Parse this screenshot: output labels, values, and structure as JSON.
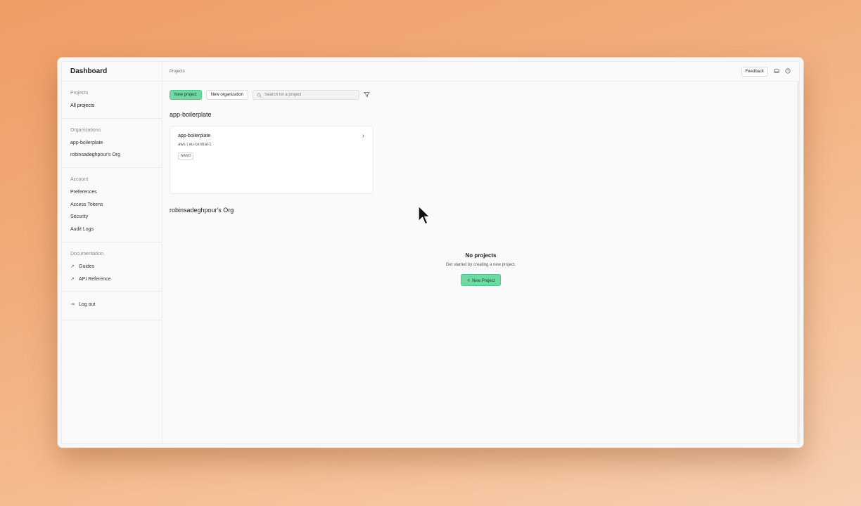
{
  "window": {
    "brand": "Dashboard",
    "breadcrumb": "Projects"
  },
  "header": {
    "feedback_label": "Feedback",
    "inbox_icon": "inbox-icon",
    "help_icon": "help-icon"
  },
  "sidebar": {
    "projects_heading": "Projects",
    "projects_items": [
      {
        "label": "All projects",
        "active": true
      }
    ],
    "organizations_heading": "Organizations",
    "organizations_items": [
      {
        "label": "app-boilerplate"
      },
      {
        "label": "robinsadeghpour's Org"
      }
    ],
    "account_heading": "Account",
    "account_items": [
      {
        "label": "Preferences"
      },
      {
        "label": "Access Tokens"
      },
      {
        "label": "Security"
      },
      {
        "label": "Audit Logs"
      }
    ],
    "documentation_heading": "Documentation",
    "documentation_items": [
      {
        "label": "Guides",
        "icon": "external-link-icon"
      },
      {
        "label": "API Reference",
        "icon": "external-link-icon"
      }
    ],
    "logout_label": "Log out"
  },
  "toolbar": {
    "new_project_label": "New project",
    "new_organization_label": "New organization",
    "search_placeholder": "Search for a project",
    "filter_icon": "filter-icon"
  },
  "organizations": [
    {
      "name": "app-boilerplate",
      "projects": [
        {
          "name": "app-boilerplate",
          "region": "aws | eu-central-1",
          "badge": "NANO"
        }
      ]
    },
    {
      "name": "robinsadeghpour's Org",
      "projects": [],
      "empty": {
        "title": "No projects",
        "subtitle": "Get started by creating a new project.",
        "button_label": "New Project"
      }
    }
  ],
  "colors": {
    "accent": "#6fd8a3",
    "background_gradient_start": "#ef9d65",
    "background_gradient_end": "#f7cfb0"
  }
}
